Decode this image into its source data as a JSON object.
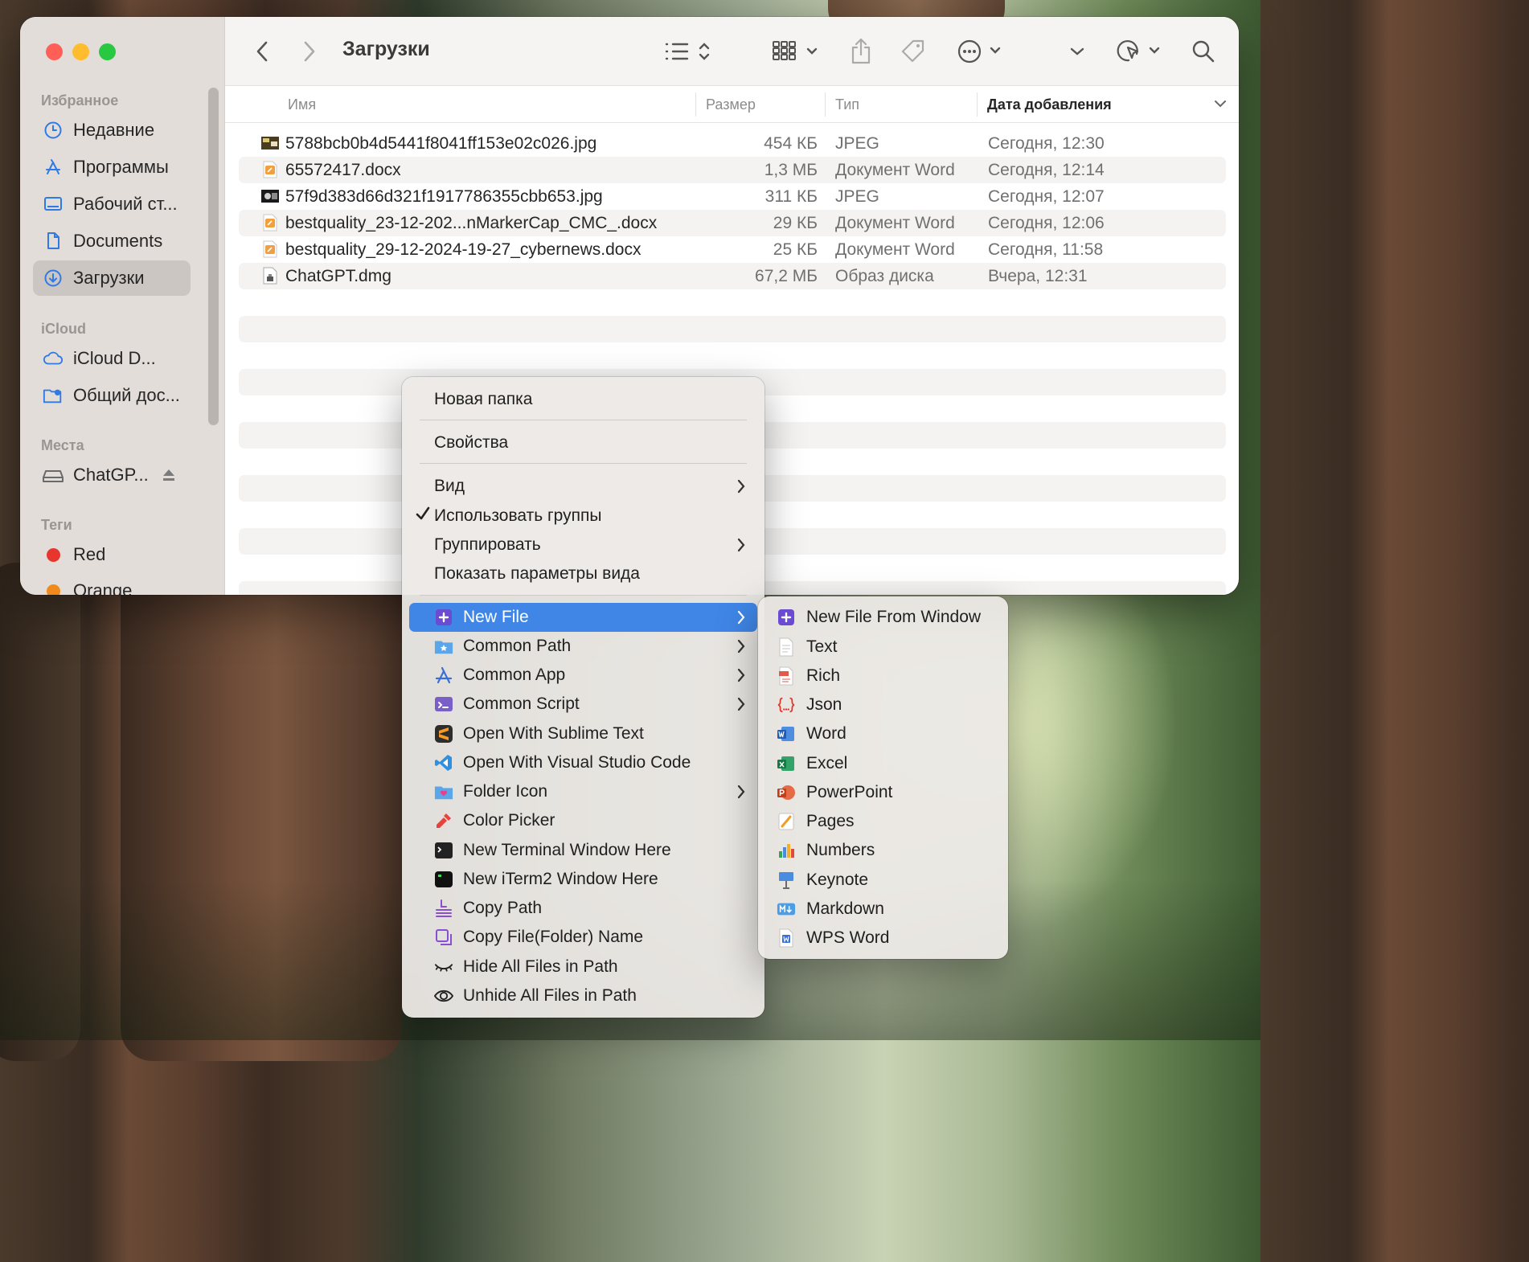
{
  "finder": {
    "title": "Загрузки",
    "sidebar": {
      "favorites_header": "Избранное",
      "favorites": [
        {
          "label": "Недавние",
          "icon": "clock-icon"
        },
        {
          "label": "Программы",
          "icon": "applications-icon"
        },
        {
          "label": "Рабочий ст...",
          "icon": "desktop-icon"
        },
        {
          "label": "Documents",
          "icon": "document-icon"
        },
        {
          "label": "Загрузки",
          "icon": "downloads-icon"
        }
      ],
      "icloud_header": "iCloud",
      "icloud": [
        {
          "label": "iCloud D...",
          "icon": "cloud-icon"
        },
        {
          "label": "Общий дос...",
          "icon": "shared-folder-icon"
        }
      ],
      "places_header": "Места",
      "places": [
        {
          "label": "ChatGP...",
          "icon": "disk-icon"
        }
      ],
      "tags_header": "Теги",
      "tags": [
        {
          "label": "Red",
          "color": "#e8352e"
        },
        {
          "label": "Orange",
          "color": "#f08a1c"
        }
      ]
    },
    "columns": {
      "name": "Имя",
      "size": "Размер",
      "type": "Тип",
      "date": "Дата добавления"
    },
    "files": [
      {
        "name": "5788bcb0b4d5441f8041ff153e02c026.jpg",
        "size": "454 КБ",
        "type": "JPEG",
        "date": "Сегодня, 12:30",
        "icon": "jpeg-thumbnail-icon"
      },
      {
        "name": "65572417.docx",
        "size": "1,3 МБ",
        "type": "Документ Word",
        "date": "Сегодня, 12:14",
        "icon": "docx-icon"
      },
      {
        "name": "57f9d383d66d321f1917786355cbb653.jpg",
        "size": "311 КБ",
        "type": "JPEG",
        "date": "Сегодня, 12:07",
        "icon": "jpeg-thumbnail-icon"
      },
      {
        "name": "bestquality_23-12-202...nMarkerCap_CMC_.docx",
        "size": "29 КБ",
        "type": "Документ Word",
        "date": "Сегодня, 12:06",
        "icon": "docx-icon"
      },
      {
        "name": "bestquality_29-12-2024-19-27_cybernews.docx",
        "size": "25 КБ",
        "type": "Документ Word",
        "date": "Сегодня, 11:58",
        "icon": "docx-icon"
      },
      {
        "name": "ChatGPT.dmg",
        "size": "67,2 МБ",
        "type": "Образ диска",
        "date": "Вчера, 12:31",
        "icon": "dmg-icon"
      }
    ]
  },
  "context_menu": {
    "new_folder": "Новая папка",
    "properties": "Свойства",
    "view": "Вид",
    "use_groups": "Использовать группы",
    "group_by": "Группировать",
    "show_view_options": "Показать параметры вида",
    "plugin_items": [
      {
        "label": "New File",
        "icon": "new-file-icon",
        "submenu": true,
        "highlighted": true
      },
      {
        "label": "Common Path",
        "icon": "folder-star-icon",
        "submenu": true
      },
      {
        "label": "Common App",
        "icon": "app-store-icon",
        "submenu": true
      },
      {
        "label": "Common Script",
        "icon": "script-icon",
        "submenu": true
      },
      {
        "label": "Open With Sublime Text",
        "icon": "sublime-text-icon",
        "submenu": false
      },
      {
        "label": "Open With Visual Studio Code",
        "icon": "vscode-icon",
        "submenu": false
      },
      {
        "label": "Folder Icon",
        "icon": "folder-heart-icon",
        "submenu": true
      },
      {
        "label": "Color Picker",
        "icon": "eyedropper-icon",
        "submenu": false
      },
      {
        "label": "New Terminal Window Here",
        "icon": "terminal-icon",
        "submenu": false
      },
      {
        "label": "New iTerm2 Window Here",
        "icon": "iterm2-icon",
        "submenu": false
      },
      {
        "label": "Copy Path",
        "icon": "path-icon",
        "submenu": false
      },
      {
        "label": "Copy File(Folder) Name",
        "icon": "copy-icon",
        "submenu": false
      },
      {
        "label": "Hide All Files in Path",
        "icon": "eye-closed-icon",
        "submenu": false
      },
      {
        "label": "Unhide All Files in Path",
        "icon": "eye-open-icon",
        "submenu": false
      }
    ]
  },
  "new_file_submenu": [
    {
      "label": "New File From Window",
      "icon": "new-file-window-icon"
    },
    {
      "label": "Text",
      "icon": "text-file-icon"
    },
    {
      "label": "Rich",
      "icon": "rtf-file-icon"
    },
    {
      "label": "Json",
      "icon": "json-file-icon"
    },
    {
      "label": "Word",
      "icon": "word-icon"
    },
    {
      "label": "Excel",
      "icon": "excel-icon"
    },
    {
      "label": "PowerPoint",
      "icon": "powerpoint-icon"
    },
    {
      "label": "Pages",
      "icon": "pages-icon"
    },
    {
      "label": "Numbers",
      "icon": "numbers-icon"
    },
    {
      "label": "Keynote",
      "icon": "keynote-icon"
    },
    {
      "label": "Markdown",
      "icon": "markdown-icon"
    },
    {
      "label": "WPS Word",
      "icon": "wps-word-icon"
    }
  ],
  "colors": {
    "accent": "#3f86e6",
    "close": "#ff5f57",
    "minimize": "#febc2e",
    "zoom": "#28c840"
  }
}
